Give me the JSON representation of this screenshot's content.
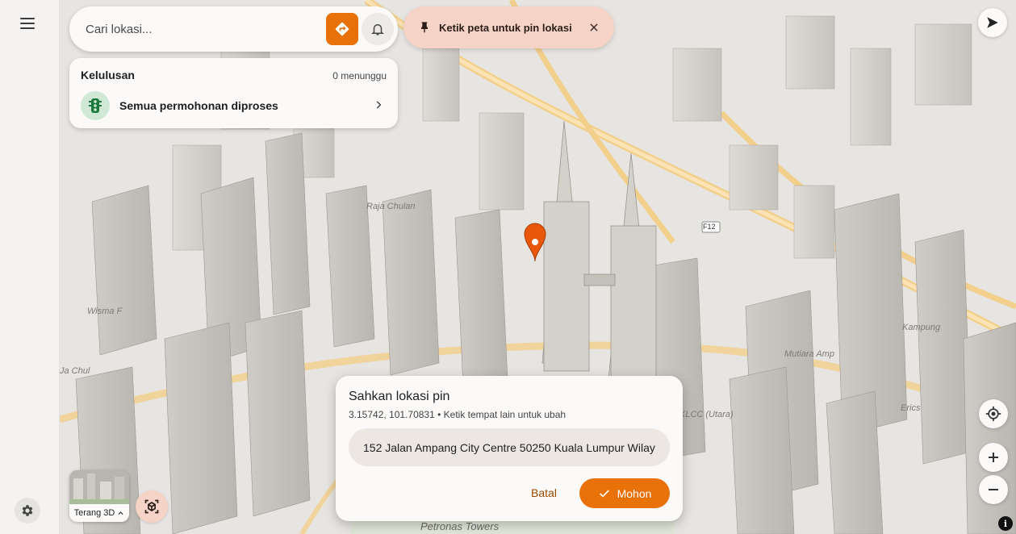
{
  "rail": {
    "menu_icon": "hamburger-menu-icon",
    "settings_icon": "gear-icon"
  },
  "search": {
    "placeholder": "Cari lokasi...",
    "value": ""
  },
  "clearance": {
    "title": "Kelulusan",
    "pending_count": "0 menunggu",
    "row_label": "Semua permohonan diproses"
  },
  "tip": {
    "text": "Ketik peta untuk pin lokasi"
  },
  "layer": {
    "label": "Terang 3D"
  },
  "confirm": {
    "title": "Sahkan lokasi pin",
    "subtitle": "3.15742, 101.70831 • Ketik tempat lain untuk ubah",
    "address": "152 Jalan Ampang City Centre 50250 Kuala Lumpur Wilayah Persekutuan",
    "cancel_label": "Batal",
    "apply_label": "Mohon"
  },
  "map_labels": {
    "petronas": "Petronas Towers",
    "kampung": "Kampung",
    "chulan": "Ja Chul",
    "wisma": "Wisma F",
    "klcc": "KLCC (Utara)",
    "f12": "F12",
    "ericsson": "Erics",
    "mutiara": "Mutiara Amp",
    "raja_chulan": "Raja Chulan"
  },
  "colors": {
    "accent": "#e8710a",
    "chip_bg": "#f5d3c7",
    "cancel_text": "#9a4b00",
    "traffic_light_bg": "#cfe9d6",
    "traffic_light_fg": "#1e7a3c"
  }
}
